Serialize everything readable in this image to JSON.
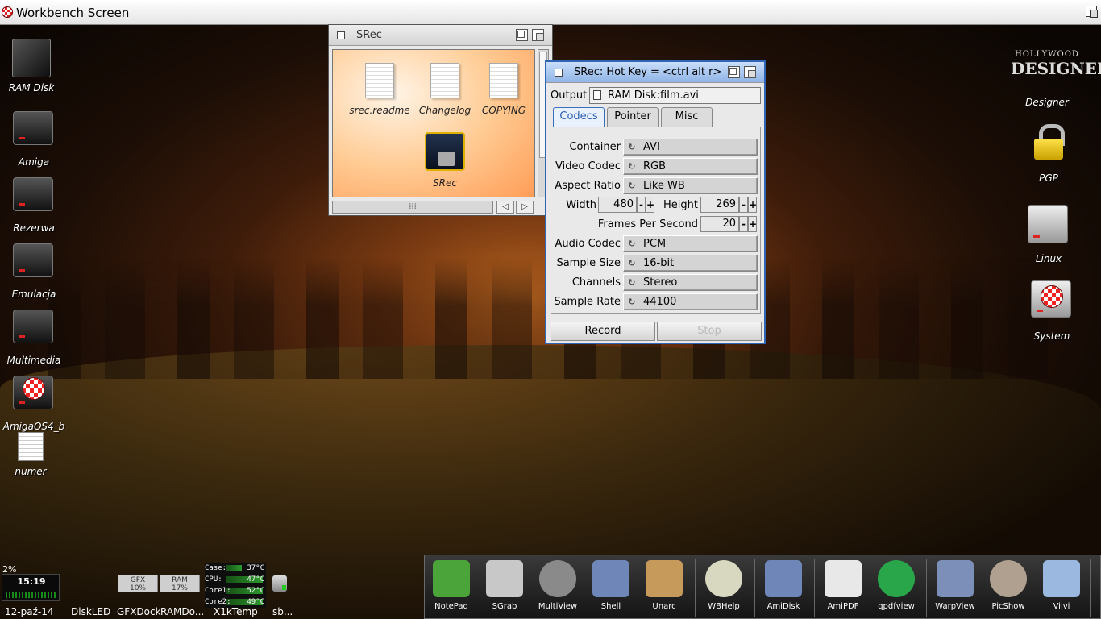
{
  "screen": {
    "title": "Workbench Screen"
  },
  "desktop_left": [
    {
      "label": "RAM Disk",
      "icon": "ram-disk-icon"
    },
    {
      "label": "Amiga",
      "icon": "drive-tools-icon"
    },
    {
      "label": "Rezerwa",
      "icon": "drive-hammer-icon"
    },
    {
      "label": "Emulacja",
      "icon": "drive-gamepad-icon"
    },
    {
      "label": "Multimedia",
      "icon": "drive-film-icon"
    },
    {
      "label": "AmigaOS4_b",
      "icon": "drive-boing-icon"
    },
    {
      "label": "numer",
      "icon": "doc-magnifier-icon"
    }
  ],
  "desktop_right": [
    {
      "label": "Designer",
      "icon": "hollywood-designer-icon",
      "logo_line1": "HOLLYWOOD",
      "logo_line2": "DESIGNER"
    },
    {
      "label": "PGP",
      "icon": "padlock-icon"
    },
    {
      "label": "Linux",
      "icon": "tux-drive-icon"
    },
    {
      "label": "System",
      "icon": "drive-boing-icon"
    }
  ],
  "drawer": {
    "title": "SRec",
    "files": [
      {
        "label": "srec.readme"
      },
      {
        "label": "Changelog"
      },
      {
        "label": "COPYING"
      },
      {
        "label": "SRec"
      }
    ]
  },
  "srec": {
    "title": "SRec: Hot Key = <ctrl alt r>",
    "output_label": "Output",
    "output_value": "RAM Disk:film.avi",
    "tabs": [
      "Codecs",
      "Pointer",
      "Misc"
    ],
    "container_label": "Container",
    "container_value": "AVI",
    "video_codec_label": "Video Codec",
    "video_codec_value": "RGB",
    "aspect_label": "Aspect Ratio",
    "aspect_value": "Like WB",
    "width_label": "Width",
    "width_value": "480",
    "height_label": "Height",
    "height_value": "269",
    "fps_label": "Frames Per Second",
    "fps_value": "20",
    "audio_codec_label": "Audio Codec",
    "audio_codec_value": "PCM",
    "sample_size_label": "Sample Size",
    "sample_size_value": "16-bit",
    "channels_label": "Channels",
    "channels_value": "Stereo",
    "sample_rate_label": "Sample Rate",
    "sample_rate_value": "44100",
    "record_label": "Record",
    "stop_label": "Stop"
  },
  "dock": [
    {
      "label": "NotePad",
      "color": "#4aa43a"
    },
    {
      "label": "SGrab",
      "color": "#c8c8c8"
    },
    {
      "label": "MultiView",
      "color": "#8a8a8a"
    },
    {
      "label": "Shell",
      "color": "#6f86b8"
    },
    {
      "label": "Unarc",
      "color": "#c69a5a"
    },
    {
      "label": "WBHelp",
      "color": "#d8d8c0"
    },
    {
      "label": "AmiDisk",
      "color": "#6f86b8"
    },
    {
      "label": "AmiPDF",
      "color": "#e8e8e8"
    },
    {
      "label": "qpdfview",
      "color": "#29a64a"
    },
    {
      "label": "WarpView",
      "color": "#7c8fb8"
    },
    {
      "label": "PicShow",
      "color": "#b0a090"
    },
    {
      "label": "Viivi",
      "color": "#9ab8e0"
    }
  ],
  "gadgets": {
    "cpu_percent": "2%",
    "time": "15:19",
    "date": "12-paź-14",
    "labels": [
      "DiskLED",
      "GFXDock",
      "RAMDo...",
      "X1kTemp",
      "sb..."
    ],
    "gfx_meter_label": "GFX",
    "gfx_meter_value": "10%",
    "ram_meter_label": "RAM",
    "ram_meter_value": "17%",
    "temps": [
      {
        "name": "Case:",
        "value": "37°C"
      },
      {
        "name": "CPU:",
        "value": "47°C"
      },
      {
        "name": "Core1:",
        "value": "52°C"
      },
      {
        "name": "Core2:",
        "value": "49°C"
      }
    ]
  }
}
